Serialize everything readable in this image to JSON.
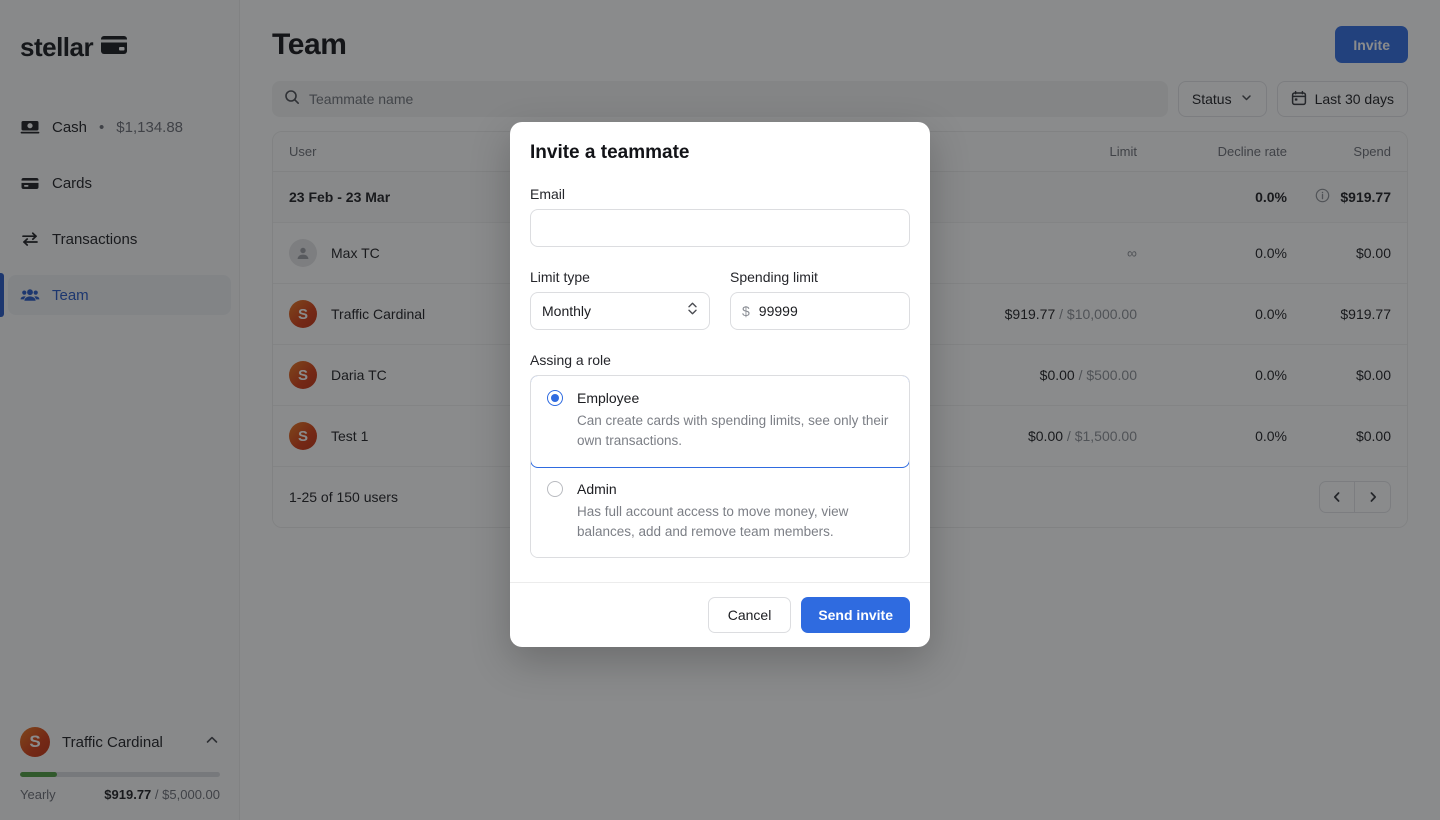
{
  "brand": {
    "name": "stellar",
    "icon": "credit-card-icon"
  },
  "sidebar": {
    "items": [
      {
        "label": "Cash",
        "separator": "•",
        "amount": "$1,134.88",
        "icon": "cash-icon",
        "active": false
      },
      {
        "label": "Cards",
        "icon": "card-icon",
        "active": false
      },
      {
        "label": "Transactions",
        "icon": "transactions-icon",
        "active": false
      },
      {
        "label": "Team",
        "icon": "team-icon",
        "active": true
      }
    ],
    "footer": {
      "avatar_initial": "S",
      "name": "Traffic Cardinal",
      "chevron": "chevron-up-icon",
      "period_label": "Yearly",
      "used": "$919.77",
      "separator": "/",
      "total": "$5,000.00",
      "progress_percent": 18.4
    }
  },
  "header": {
    "title": "Team",
    "invite_label": "Invite"
  },
  "toolbar": {
    "search_placeholder": "Teammate name",
    "search_value": "",
    "status_label": "Status",
    "date_label": "Last 30 days"
  },
  "table": {
    "columns": [
      "User",
      "Limit",
      "Decline rate",
      "Spend"
    ],
    "group_row": {
      "label": "23 Feb - 23 Mar",
      "limit": "",
      "decline_rate": "0.0%",
      "spend": "$919.77",
      "has_info_icon": true
    },
    "rows": [
      {
        "name": "Max TC",
        "avatar": "placeholder",
        "avatar_initial": "",
        "limit_used": "",
        "limit_total": "",
        "limit_display": "∞",
        "decline_rate": "0.0%",
        "spend": "$0.00"
      },
      {
        "name": "Traffic Cardinal",
        "avatar": "logo",
        "avatar_initial": "S",
        "limit_used": "$919.77",
        "limit_total": "$10,000.00",
        "limit_display": "",
        "decline_rate": "0.0%",
        "spend": "$919.77"
      },
      {
        "name": "Daria TC",
        "avatar": "logo",
        "avatar_initial": "S",
        "limit_used": "$0.00",
        "limit_total": "$500.00",
        "limit_display": "",
        "decline_rate": "0.0%",
        "spend": "$0.00"
      },
      {
        "name": "Test 1",
        "avatar": "logo",
        "avatar_initial": "S",
        "limit_used": "$0.00",
        "limit_total": "$1,500.00",
        "limit_display": "",
        "decline_rate": "0.0%",
        "spend": "$0.00"
      }
    ],
    "footer": {
      "count_text": "1-25 of 150 users",
      "prev_icon": "chevron-left-icon",
      "next_icon": "chevron-right-icon"
    }
  },
  "modal": {
    "title": "Invite a teammate",
    "email": {
      "label": "Email",
      "value": "",
      "placeholder": ""
    },
    "limit_type": {
      "label": "Limit type",
      "value": "Monthly"
    },
    "spending_limit": {
      "label": "Spending limit",
      "currency_symbol": "$",
      "value": "99999"
    },
    "role_section_label": "Assing a role",
    "roles": [
      {
        "name": "Employee",
        "description": "Can create cards with spending limits, see only their own transactions.",
        "selected": true
      },
      {
        "name": "Admin",
        "description": "Has full account access to move money, view balances, add and remove team members.",
        "selected": false
      }
    ],
    "cancel_label": "Cancel",
    "submit_label": "Send invite"
  },
  "colors": {
    "accent_blue": "#2f6be0",
    "sidebar_active_blue": "#2457c5",
    "avatar_orange": "#d23a12",
    "progress_green": "#4c9a3f"
  }
}
